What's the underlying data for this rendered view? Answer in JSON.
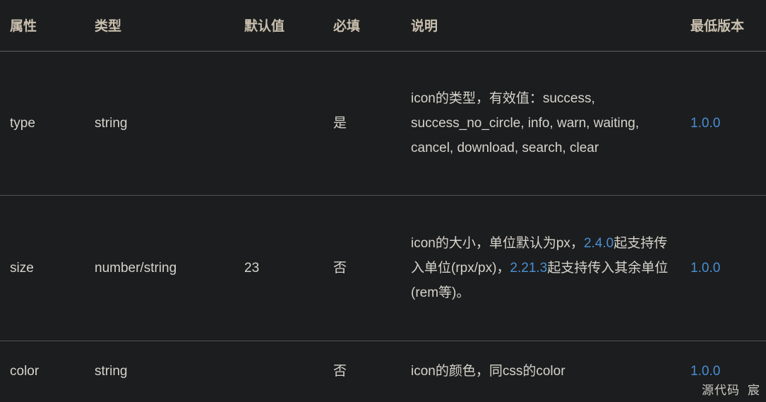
{
  "table": {
    "headers": [
      {
        "key": "attribute",
        "label": "属性"
      },
      {
        "key": "type",
        "label": "类型"
      },
      {
        "key": "default",
        "label": "默认值"
      },
      {
        "key": "required",
        "label": "必填"
      },
      {
        "key": "description",
        "label": "说明"
      },
      {
        "key": "min_version",
        "label": "最低版本"
      }
    ],
    "rows": [
      {
        "attribute": "type",
        "type": "string",
        "default": "",
        "required": "是",
        "description": "icon的类型，有效值：success, success_no_circle, info, warn, waiting, cancel, download, search, clear",
        "min_version": "1.0.0"
      },
      {
        "attribute": "size",
        "type": "number/string",
        "default": "23",
        "required": "否",
        "description_parts": [
          {
            "text": "icon的大小，单位默认为px，",
            "link": false
          },
          {
            "text": "2.4.0",
            "link": true
          },
          {
            "text": "起支持传入单位(rpx/px)，",
            "link": false
          },
          {
            "text": "2.21.3",
            "link": true
          },
          {
            "text": "起支持传入其余单位(rem等)。",
            "link": false
          }
        ],
        "min_version": "1.0.0"
      },
      {
        "attribute": "color",
        "type": "string",
        "default": "",
        "required": "否",
        "description": "icon的颜色，同css的color",
        "min_version": "1.0.0"
      }
    ]
  },
  "watermark": {
    "left": "源代码",
    "right": "宸"
  },
  "colors": {
    "background": "#1b1d1e",
    "header_text": "#c9bfae",
    "body_text": "#d7d3cc",
    "link": "#4a8fd4",
    "divider": "#4e5253"
  }
}
